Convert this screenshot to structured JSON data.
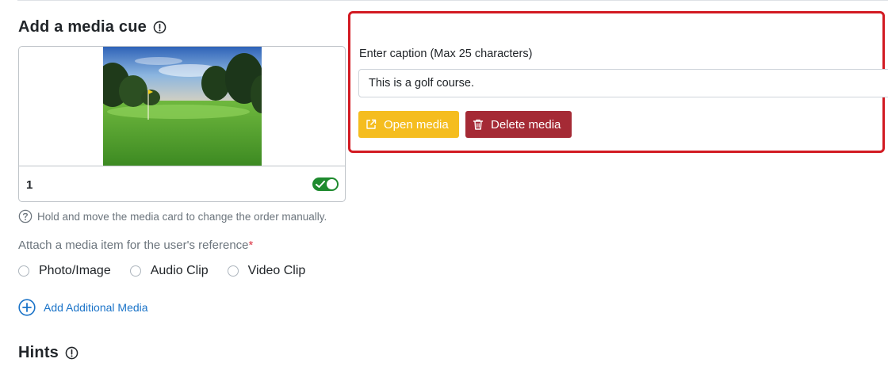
{
  "media_section": {
    "title": "Add a media cue",
    "title_icon": "info-circle-icon",
    "card": {
      "index": "1",
      "visible_toggle": true,
      "thumbnail": "golf-course-photo"
    },
    "help_text": "Hold and move the media card to change the order manually.",
    "attach_label": "Attach a media item for the user's reference",
    "required_marker": "*",
    "options": [
      {
        "label": "Photo/Image",
        "selected": false
      },
      {
        "label": "Audio Clip",
        "selected": false
      },
      {
        "label": "Video Clip",
        "selected": false
      }
    ],
    "add_additional": "Add Additional Media"
  },
  "caption_panel": {
    "label": "Enter caption (Max 25 characters)",
    "value": "This is a golf course.",
    "open_label": "Open media",
    "delete_label": "Delete media"
  },
  "hints_section": {
    "title": "Hints"
  },
  "colors": {
    "open_button": "#f5bd1f",
    "delete_button": "#a52a35",
    "highlight": "#d21a22",
    "toggle_on": "#1e8a2e",
    "link": "#1a73c8"
  }
}
